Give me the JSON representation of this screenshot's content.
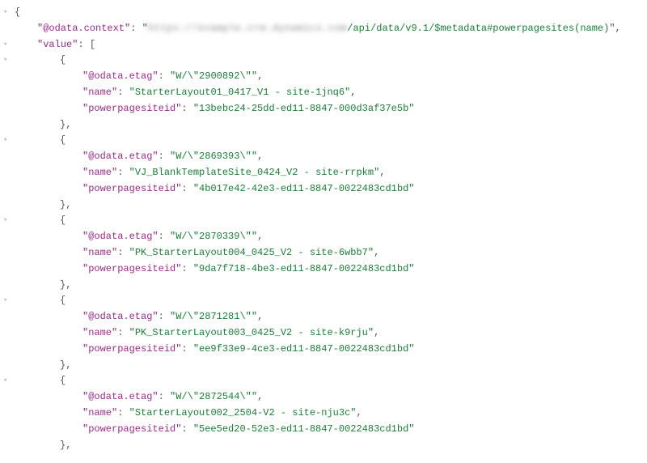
{
  "odata_context_key": "\"@odata.context\"",
  "odata_context_hidden": "https://example.crm.dynamics.com",
  "odata_context_tail": "/api/data/v9.1/$metadata#powerpagesites(name)",
  "value_key": "\"value\"",
  "etag_key": "\"@odata.etag\"",
  "name_key": "\"name\"",
  "siteid_key": "\"powerpagesiteid\"",
  "items": [
    {
      "etag": "\"W/\\\"2900892\\\"\"",
      "name": "\"StarterLayout01_0417_V1 - site-1jnq6\"",
      "siteid": "\"13bebc24-25dd-ed11-8847-000d3af37e5b\""
    },
    {
      "etag": "\"W/\\\"2869393\\\"\"",
      "name": "\"VJ_BlankTemplateSite_0424_V2 - site-rrpkm\"",
      "siteid": "\"4b017e42-42e3-ed11-8847-0022483cd1bd\""
    },
    {
      "etag": "\"W/\\\"2870339\\\"\"",
      "name": "\"PK_StarterLayout004_0425_V2 - site-6wbb7\"",
      "siteid": "\"9da7f718-4be3-ed11-8847-0022483cd1bd\""
    },
    {
      "etag": "\"W/\\\"2871281\\\"\"",
      "name": "\"PK_StarterLayout003_0425_V2 - site-k9rju\"",
      "siteid": "\"ee9f33e9-4ce3-ed11-8847-0022483cd1bd\""
    },
    {
      "etag": "\"W/\\\"2872544\\\"\"",
      "name": "\"StarterLayout002_2504-V2 - site-nju3c\"",
      "siteid": "\"5ee5ed20-52e3-ed11-8847-0022483cd1bd\""
    }
  ],
  "brace_open": "{",
  "brace_close": "}",
  "bracket_open": "[",
  "close_with_comma": "},",
  "colon_space": ": ",
  "comma": ",",
  "quote": "\""
}
